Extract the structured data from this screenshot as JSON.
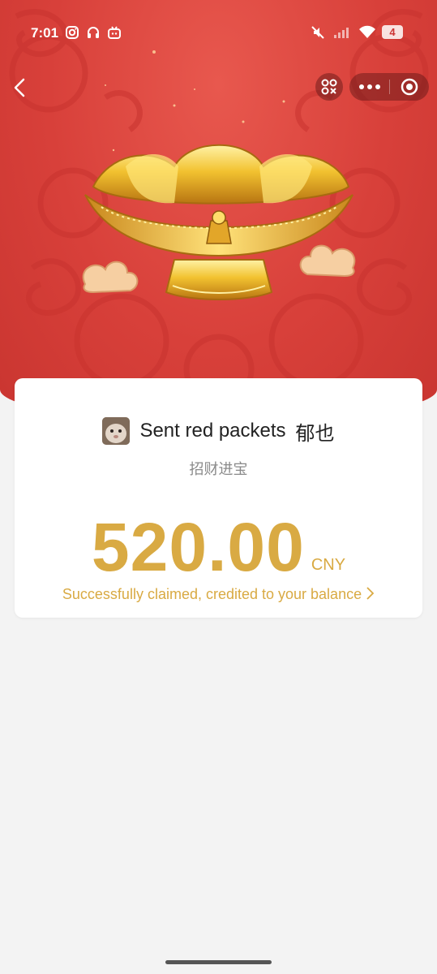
{
  "status_bar": {
    "time": "7:01",
    "battery": "4",
    "left_icons": [
      "instagram-icon",
      "headphones-icon",
      "bilibili-icon"
    ],
    "right_icons": [
      "mute-icon",
      "signal-icon",
      "wifi-icon",
      "battery-icon"
    ]
  },
  "toolbar": {
    "back_icon": "chevron-left-icon",
    "scan_icon": "scan-icon",
    "more_icon": "more-dots-icon",
    "close_icon": "target-close-icon"
  },
  "hero": {
    "image": "golden-treasure-bowl",
    "background_color": "#d8403a"
  },
  "card": {
    "sender_text": "Sent red packets",
    "sender_name": "郁也",
    "wish": "招财进宝",
    "amount": "520.00",
    "currency": "CNY",
    "status_text": "Successfully claimed, credited to your balance",
    "accent_color": "#d9aa43"
  }
}
